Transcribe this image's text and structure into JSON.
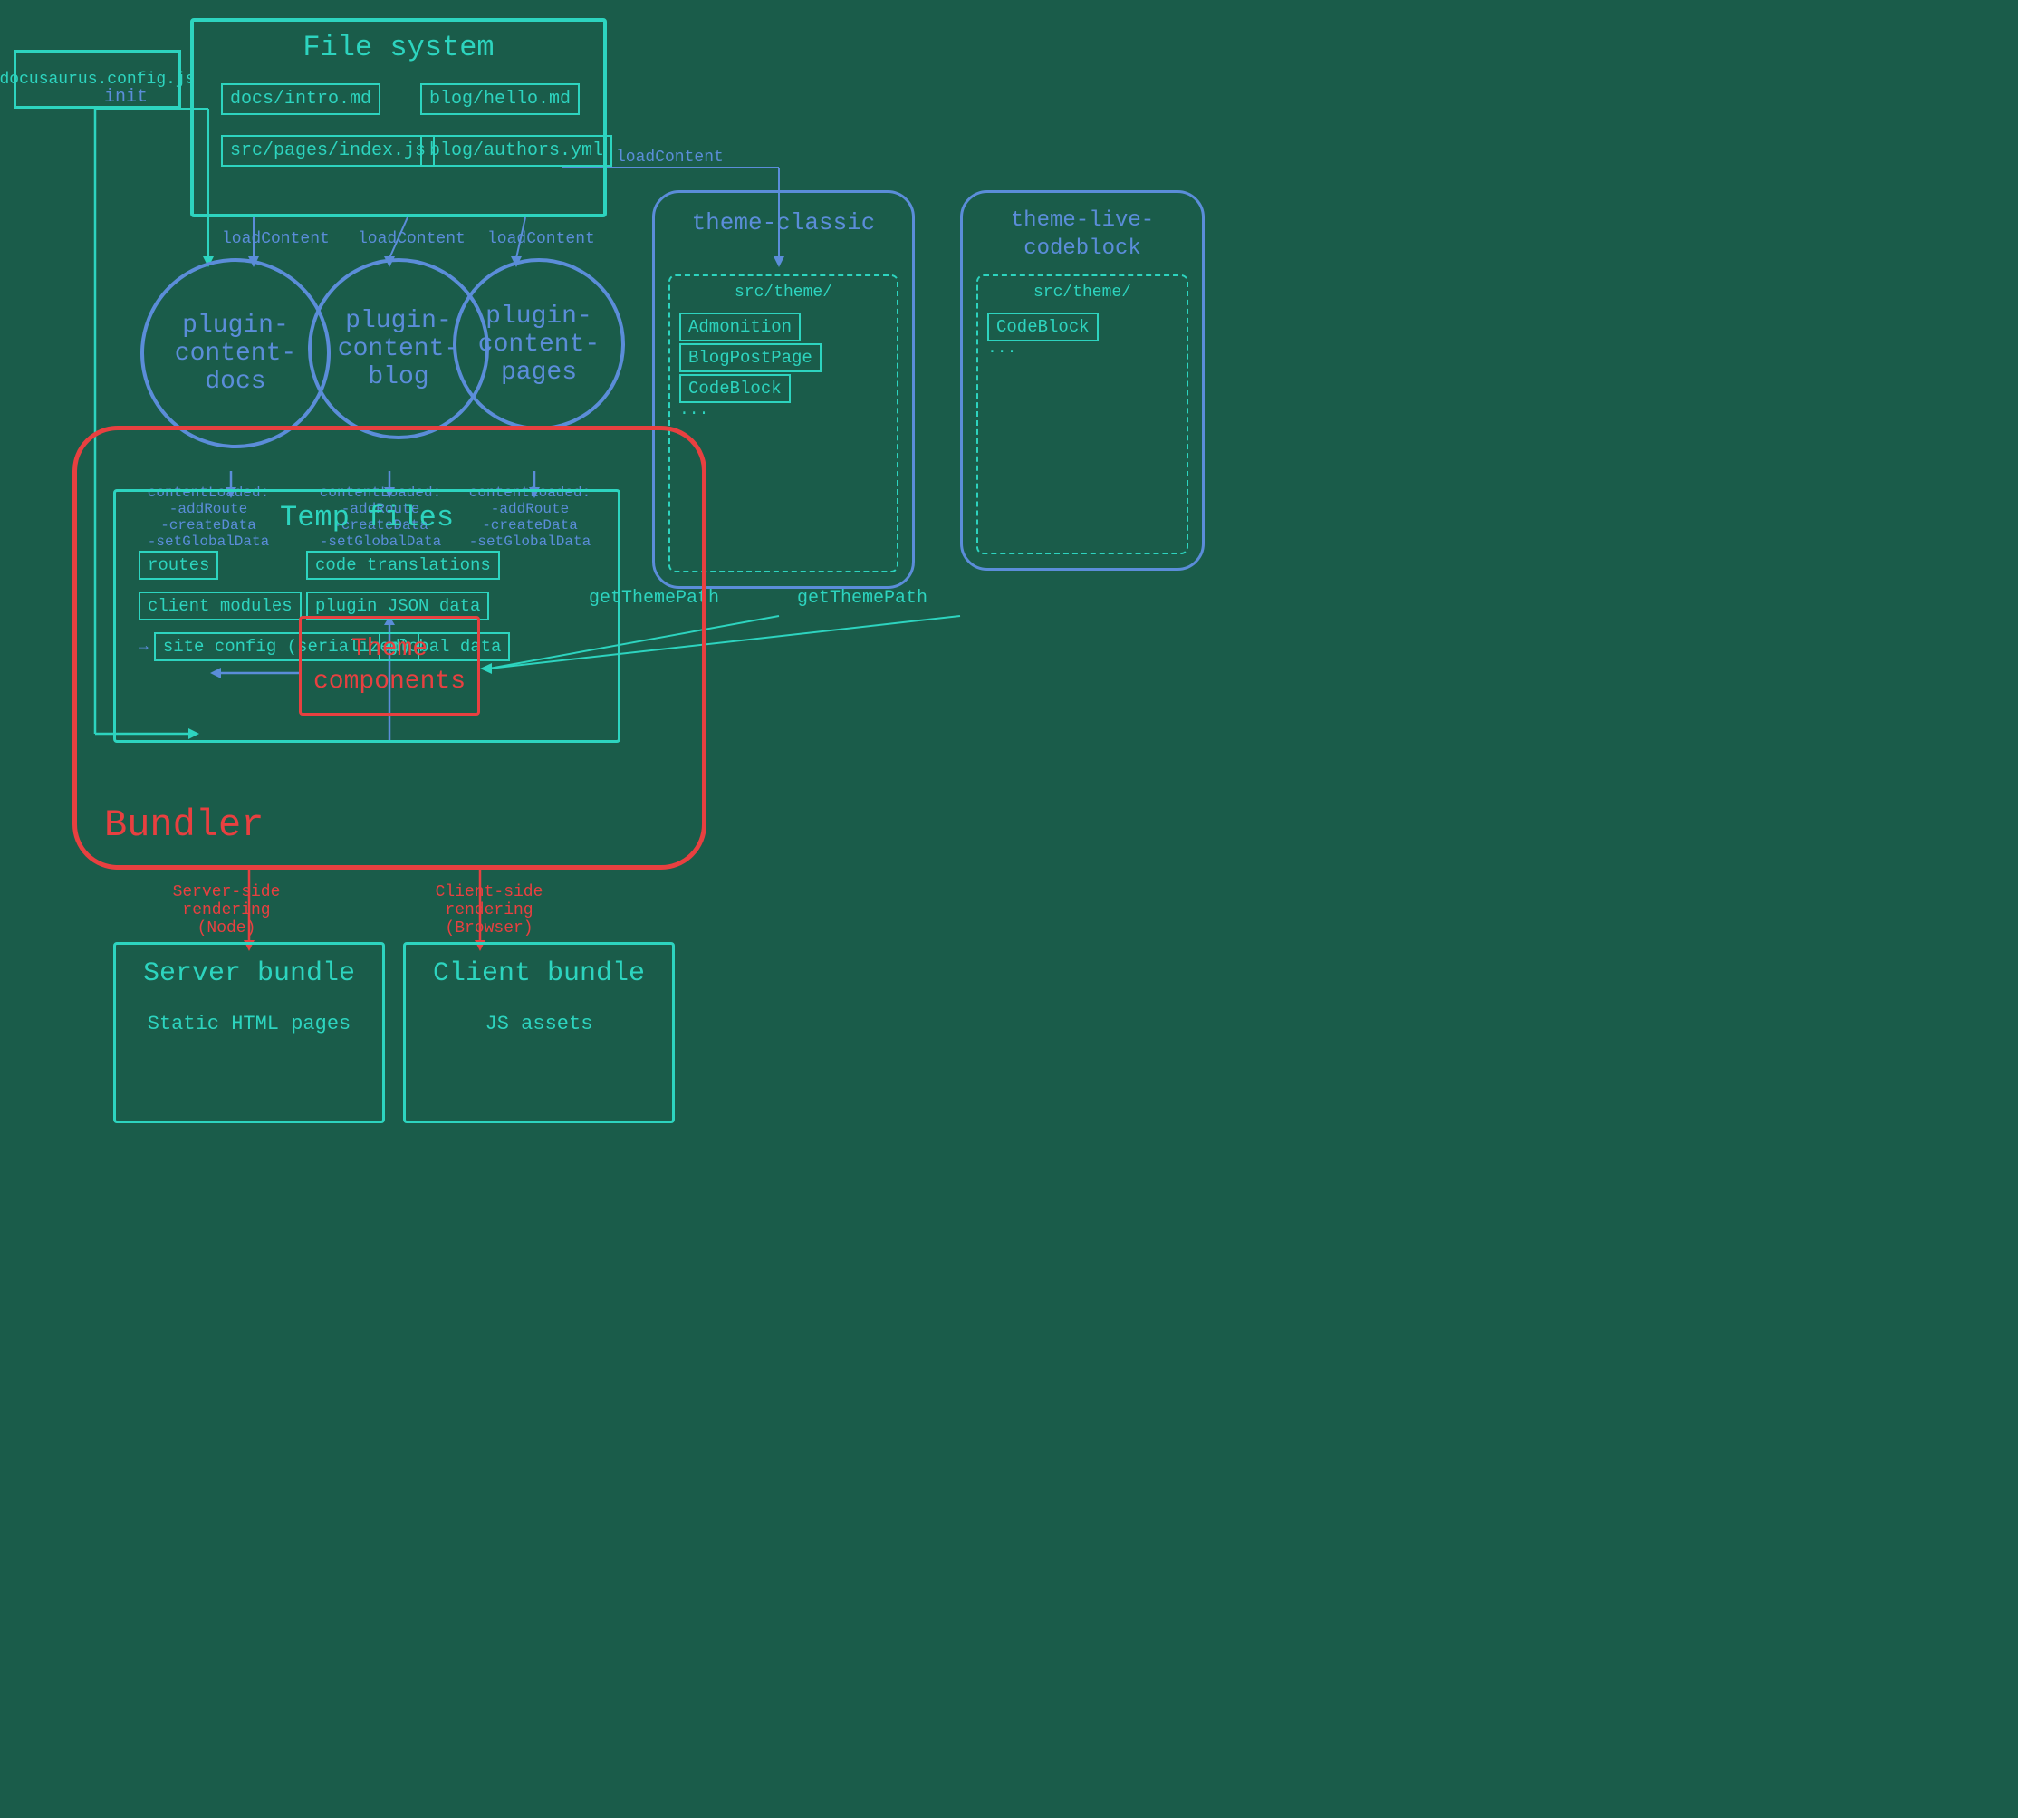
{
  "background_color": "#1a5c4a",
  "accent_teal": "#2dd4bf",
  "accent_blue": "#5b8dd9",
  "accent_red": "#e84040",
  "file_system": {
    "title": "File system",
    "items": [
      "docs/intro.md",
      "blog/hello.md",
      "src/pages/index.js",
      "blog/authors.yml"
    ]
  },
  "config_file": "docusaurus.config.js",
  "plugins": [
    {
      "label": "plugin-\ncontent-\ndocs"
    },
    {
      "label": "plugin-\ncontent-\nblog"
    },
    {
      "label": "plugin-\ncontent-\npages"
    }
  ],
  "theme_classic": {
    "title": "theme-classic",
    "src_path": "src/theme/",
    "items": [
      "Admonition",
      "BlogPostPage",
      "CodeBlock",
      "..."
    ]
  },
  "theme_live": {
    "title": "theme-live-\ncodeblock",
    "src_path": "src/theme/",
    "items": [
      "CodeBlock",
      "..."
    ]
  },
  "temp_files": {
    "title": "Temp files",
    "items": [
      "routes",
      "code translations",
      "client modules",
      "plugin JSON data",
      "site config (serialized)",
      "global data"
    ]
  },
  "bundler": {
    "label": "Bundler"
  },
  "theme_components": {
    "label": "Theme\ncomponents"
  },
  "server_bundle": {
    "title": "Server bundle",
    "subtitle": "Static HTML pages"
  },
  "client_bundle": {
    "title": "Client bundle",
    "subtitle": "JS assets"
  },
  "arrows": {
    "init_label": "init",
    "load_content_labels": [
      "loadContent",
      "loadContent",
      "loadContent"
    ],
    "content_loaded_labels": [
      "contentLoaded:\n-addRoute\n-createData\n-setGlobalData",
      "contentLoaded:\n-addRoute\n-createData\n-setGlobalData",
      "contentLoaded:\n-addRoute\n-createData\n-setGlobalData"
    ],
    "get_theme_path_labels": [
      "getThemePath",
      "getThemePath"
    ],
    "server_render_label": "Server-side rendering\n(Node)",
    "client_render_label": "Client-side rendering\n(Browser)"
  }
}
